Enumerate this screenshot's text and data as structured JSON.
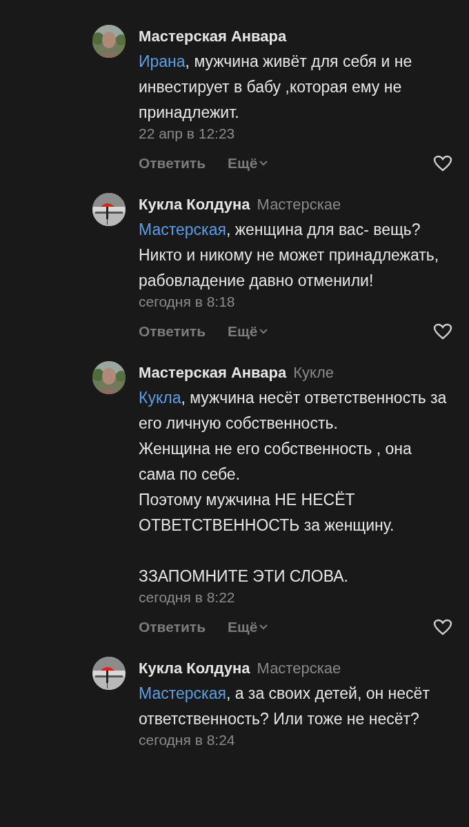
{
  "comments": [
    {
      "author": "Мастерская Анвара",
      "mention": "Ирана",
      "text": ", мужчина живёт для себя и не инвестирует в бабу ,которая ему не принадлежит.",
      "date": "22 апр в 12:23",
      "reply": "Ответить",
      "more": "Ещё"
    },
    {
      "author": "Кукла Колдуна",
      "reply_to": "Мастерскае",
      "mention": "Мастерская",
      "text": ", женщина для вас- вещь? Никто и никому не может принадлежать, рабовладение давно отменили!",
      "date": "сегодня в 8:18",
      "reply": "Ответить",
      "more": "Ещё"
    },
    {
      "author": "Мастерская Анвара",
      "reply_to": "Кукле",
      "mention": "Кукла",
      "text": ", мужчина несёт ответственность за его личную собственность.\nЖенщина не его собственность , она сама по себе.\nПоэтому мужчина НЕ НЕСЁТ ОТВЕТСТВЕННОСТЬ за женщину.\n\nЗЗАПОМНИТЕ ЭТИ СЛОВА.",
      "date": "сегодня в 8:22",
      "reply": "Ответить",
      "more": "Ещё"
    },
    {
      "author": "Кукла Колдуна",
      "reply_to": "Мастерскае",
      "mention": "Мастерская",
      "text": ", а за своих детей, он несёт ответственность? Или тоже не несёт?",
      "date": "сегодня в 8:24"
    }
  ]
}
